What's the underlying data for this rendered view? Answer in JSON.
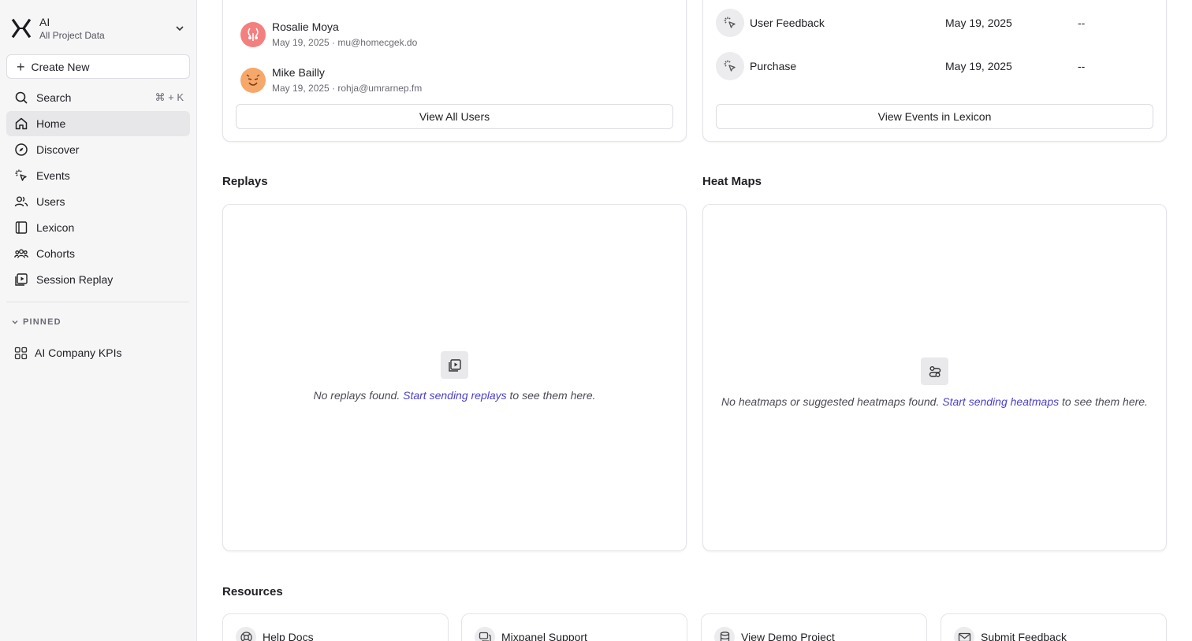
{
  "project": {
    "name": "AI",
    "subtitle": "All Project Data"
  },
  "sidebar": {
    "create_label": "Create New",
    "items": [
      {
        "label": "Search",
        "icon": "search-icon",
        "shortcut": "⌘ + K"
      },
      {
        "label": "Home",
        "icon": "home-icon",
        "active": true
      },
      {
        "label": "Discover",
        "icon": "compass-icon"
      },
      {
        "label": "Events",
        "icon": "cursor-click-icon"
      },
      {
        "label": "Users",
        "icon": "users-icon"
      },
      {
        "label": "Lexicon",
        "icon": "book-icon"
      },
      {
        "label": "Cohorts",
        "icon": "cohorts-icon"
      },
      {
        "label": "Session Replay",
        "icon": "replay-icon"
      }
    ],
    "pinned_label": "PINNED",
    "pinned_items": [
      {
        "label": "AI Company KPIs",
        "icon": "dashboard-grid-icon"
      }
    ]
  },
  "users_card": {
    "users": [
      {
        "name": "Rosalie Moya",
        "meta": "May 19, 2025 · mu@homecgek.do",
        "avatar_color": "#f47f7f"
      },
      {
        "name": "Mike Bailly",
        "meta": "May 19, 2025 · rohja@umrarnep.fm",
        "avatar_color": "#f5a86a"
      }
    ],
    "button_label": "View All Users"
  },
  "events_card": {
    "events": [
      {
        "name": "User Feedback",
        "date": "May 19, 2025",
        "value": "--"
      },
      {
        "name": "Purchase",
        "date": "May 19, 2025",
        "value": "--"
      }
    ],
    "button_label": "View Events in Lexicon"
  },
  "replays": {
    "title": "Replays",
    "empty_prefix": "No replays found.",
    "link": "Start sending replays",
    "empty_suffix": "to see them here."
  },
  "heatmaps": {
    "title": "Heat Maps",
    "empty_prefix": "No heatmaps or suggested heatmaps found.",
    "link": "Start sending heatmaps",
    "empty_suffix": "to see them here."
  },
  "resources": {
    "title": "Resources",
    "items": [
      {
        "label": "Help Docs",
        "icon": "lifebuoy-icon"
      },
      {
        "label": "Mixpanel Support",
        "icon": "chat-icon"
      },
      {
        "label": "View Demo Project",
        "icon": "database-icon"
      },
      {
        "label": "Submit Feedback",
        "icon": "mail-icon"
      }
    ]
  },
  "colors": {
    "link": "#4a3fc9",
    "sidebar_bg": "#f6f6f7",
    "active_bg": "#e7e7ea"
  }
}
